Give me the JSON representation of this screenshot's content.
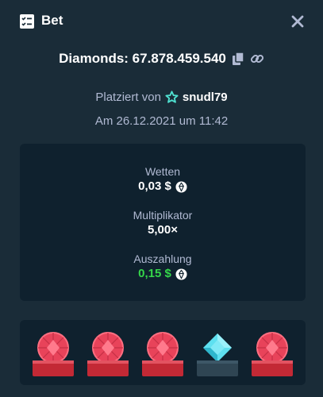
{
  "header": {
    "title": "Bet",
    "icon": "bet-slip-icon"
  },
  "bet": {
    "title": "Diamonds: 67.878.459.540",
    "placed_by_label": "Platziert von",
    "username": "snudl79",
    "date": "Am 26.12.2021 um 11:42"
  },
  "stats": {
    "wager_label": "Wetten",
    "wager_value": "0,03 $",
    "multiplier_label": "Multiplikator",
    "multiplier_value": "5,00×",
    "payout_label": "Auszahlung",
    "payout_value": "0,15 $"
  },
  "gems": [
    {
      "type": "ruby",
      "matched": true
    },
    {
      "type": "ruby",
      "matched": true
    },
    {
      "type": "ruby",
      "matched": true
    },
    {
      "type": "diamond",
      "matched": false
    },
    {
      "type": "ruby",
      "matched": true
    }
  ],
  "colors": {
    "background": "#1a2c38",
    "panel": "#0f212e",
    "muted_text": "#b1bad3",
    "payout_green": "#35d64a",
    "ruby": "#e8435a",
    "diamond": "#5ee0f0",
    "pedestal_red": "#c32935",
    "pedestal_grey": "#2f4553"
  }
}
